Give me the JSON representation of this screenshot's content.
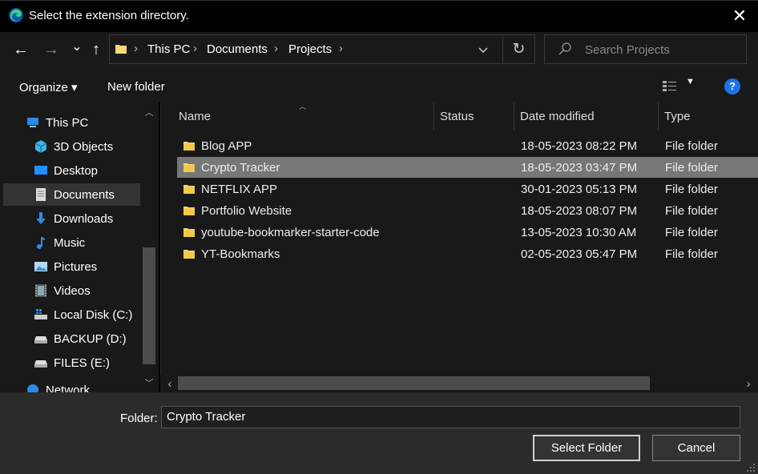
{
  "window": {
    "title": "Select the extension directory.",
    "app_icon": "edge-logo-icon",
    "close_glyph": "✕"
  },
  "nav": {
    "back_glyph": "←",
    "forward_glyph": "→",
    "recent_glyph": "⌄",
    "up_glyph": "↑",
    "breadcrumbs": [
      "This PC",
      "Documents",
      "Projects"
    ],
    "crumb_separator": "›",
    "refresh_glyph": "↻",
    "search_placeholder": "Search Projects"
  },
  "toolbar": {
    "organize_label": "Organize ▾",
    "new_folder_label": "New folder",
    "view_dropdown_glyph": "▼",
    "help_glyph": "?"
  },
  "sidebar": {
    "items": [
      {
        "label": "This PC",
        "icon": "computer-icon",
        "selected": false
      },
      {
        "label": "3D Objects",
        "icon": "cube-icon",
        "selected": false
      },
      {
        "label": "Desktop",
        "icon": "desktop-icon",
        "selected": false
      },
      {
        "label": "Documents",
        "icon": "documents-icon",
        "selected": true
      },
      {
        "label": "Downloads",
        "icon": "download-icon",
        "selected": false
      },
      {
        "label": "Music",
        "icon": "music-icon",
        "selected": false
      },
      {
        "label": "Pictures",
        "icon": "pictures-icon",
        "selected": false
      },
      {
        "label": "Videos",
        "icon": "videos-icon",
        "selected": false
      },
      {
        "label": "Local Disk (C:)",
        "icon": "windows-drive-icon",
        "selected": false
      },
      {
        "label": "BACKUP (D:)",
        "icon": "drive-icon",
        "selected": false
      },
      {
        "label": "FILES (E:)",
        "icon": "drive-icon",
        "selected": false
      },
      {
        "label": "Network",
        "icon": "network-icon",
        "selected": false
      }
    ],
    "scroll_up_glyph": "︿",
    "scroll_down_glyph": "﹀"
  },
  "files": {
    "columns": [
      "Name",
      "Status",
      "Date modified",
      "Type"
    ],
    "sort_glyph": "︿",
    "rows": [
      {
        "name": "Blog APP",
        "status": "",
        "date": "18-05-2023 08:22 PM",
        "type": "File folder",
        "selected": false
      },
      {
        "name": "Crypto Tracker",
        "status": "",
        "date": "18-05-2023 03:47 PM",
        "type": "File folder",
        "selected": true
      },
      {
        "name": "NETFLIX APP",
        "status": "",
        "date": "30-01-2023 05:13 PM",
        "type": "File folder",
        "selected": false
      },
      {
        "name": "Portfolio Website",
        "status": "",
        "date": "18-05-2023 08:07 PM",
        "type": "File folder",
        "selected": false
      },
      {
        "name": "youtube-bookmarker-starter-code",
        "status": "",
        "date": "13-05-2023 10:30 AM",
        "type": "File folder",
        "selected": false
      },
      {
        "name": "YT-Bookmarks",
        "status": "",
        "date": "02-05-2023 05:47 PM",
        "type": "File folder",
        "selected": false
      }
    ],
    "hscroll_left_glyph": "‹",
    "hscroll_right_glyph": "›"
  },
  "footer": {
    "folder_label": "Folder:",
    "folder_value": "Crypto Tracker",
    "select_button": "Select Folder",
    "cancel_button": "Cancel"
  },
  "colors": {
    "background": "#191919",
    "title_bar": "#000000",
    "footer": "#2b2b2b",
    "selected_row": "#777777",
    "selected_sidebar": "#333333",
    "folder_yellow": "#f8d775",
    "accent_blue": "#1a73e8"
  }
}
